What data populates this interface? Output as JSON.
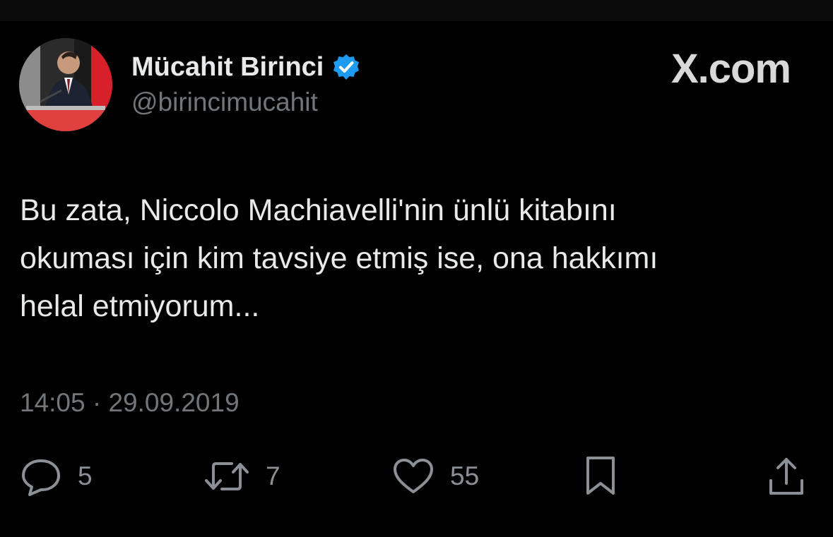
{
  "post": {
    "author": {
      "display_name": "Mücahit Birinci",
      "handle": "@birincimucahit",
      "verified_icon": "verified-badge-icon",
      "verified_color": "#1d9bf0"
    },
    "brand": "X.com",
    "text_lines": [
      "Bu zata, Niccolo Machiavelli'nin ünlü kitabını",
      "okuması için kim tavsiye etmiş ise, ona hakkımı",
      "helal etmiyorum..."
    ],
    "timestamp": "14:05 · 29.09.2019",
    "actions": {
      "replies": {
        "icon": "reply-icon",
        "count": "5"
      },
      "reposts": {
        "icon": "repost-icon",
        "count": "7"
      },
      "likes": {
        "icon": "like-icon",
        "count": "55"
      },
      "bookmark": {
        "icon": "bookmark-icon"
      },
      "share": {
        "icon": "share-icon"
      }
    }
  },
  "colors": {
    "background": "#000000",
    "text_primary": "#e7e9ea",
    "text_secondary": "#71767b"
  }
}
